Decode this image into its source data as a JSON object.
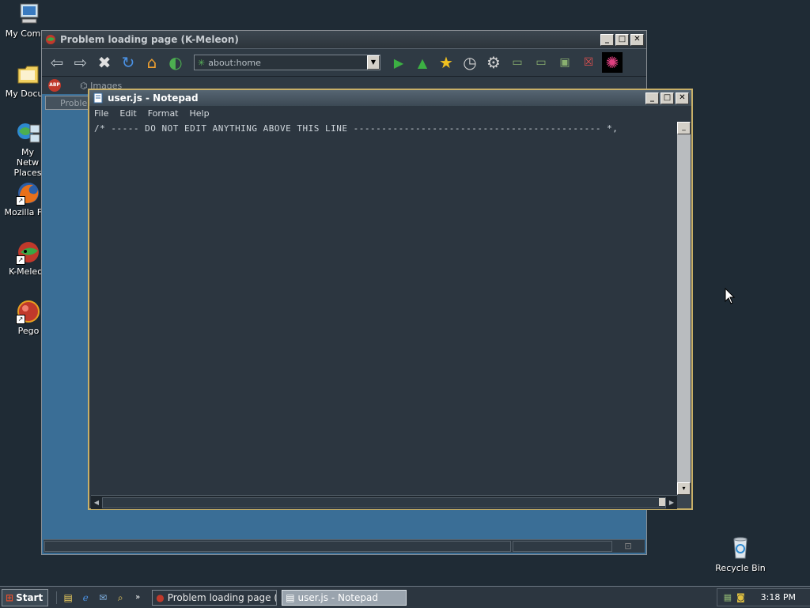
{
  "desktop": {
    "icons": [
      {
        "label": "My Compu"
      },
      {
        "label": "My Docum"
      },
      {
        "label": "My Netw Places"
      },
      {
        "label": "Mozilla Fire"
      },
      {
        "label": "K-Meleon"
      },
      {
        "label": "Pego"
      }
    ],
    "recycle_bin": "Recycle Bin"
  },
  "kmeleon": {
    "title": "Problem loading page (K-Meleon)",
    "url": "about:home",
    "bookmark_bar_item": "Images",
    "tab_label": "Proble"
  },
  "notepad": {
    "title": "user.js - Notepad",
    "menu": [
      "File",
      "Edit",
      "Format",
      "Help"
    ],
    "content": "/* ----- DO NOT EDIT ANYTHING ABOVE THIS LINE -------------------------------------------- *,"
  },
  "taskbar": {
    "start_label": "Start",
    "tasks": [
      {
        "label": "Problem loading page (K-..."
      },
      {
        "label": "user.js - Notepad"
      }
    ],
    "clock": "3:18 PM"
  },
  "colors": {
    "desktop_bg": "#1f2b35",
    "notepad_border": "#c8b068",
    "active_task_bg": "#9aa4ae"
  }
}
